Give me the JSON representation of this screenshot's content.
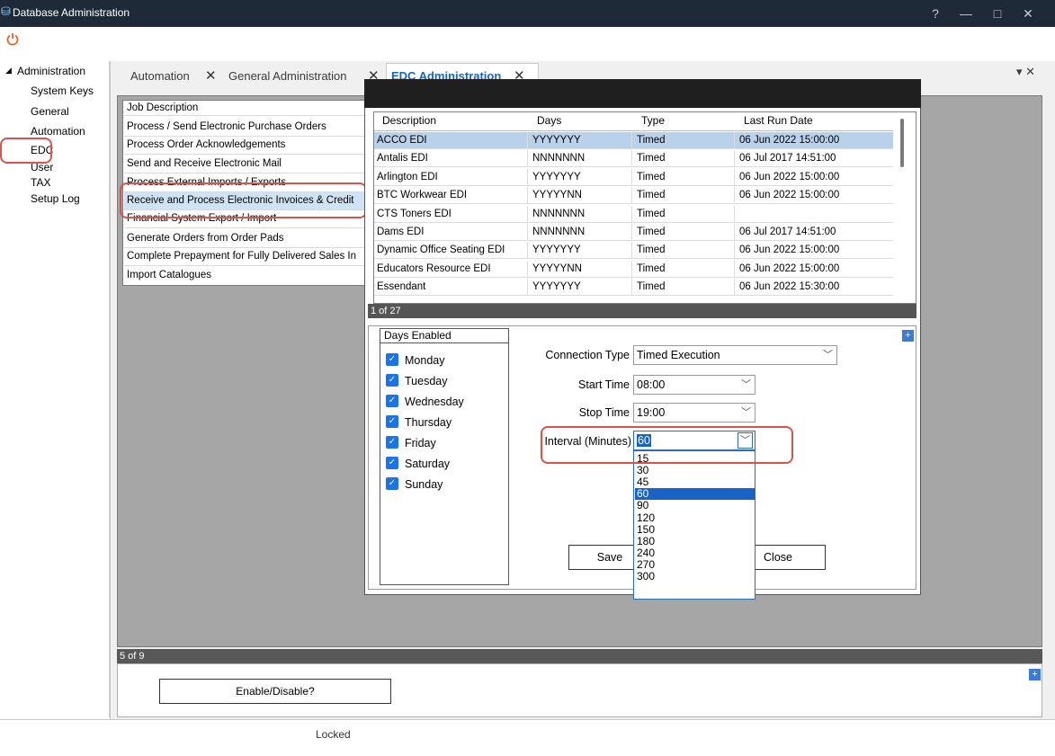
{
  "window": {
    "title": "Database Administration",
    "help": "?",
    "minimize": "—",
    "maximize": "□",
    "close": "✕"
  },
  "sidebar": {
    "root": "Administration",
    "items": [
      "System Keys",
      "General",
      "Automation",
      "EDC",
      "User",
      "TAX",
      "Setup Log"
    ]
  },
  "tabs": [
    {
      "label": "Automation",
      "close": "✕"
    },
    {
      "label": "General Administration",
      "close": "✕"
    },
    {
      "label": "EDC Administration",
      "close": "✕"
    }
  ],
  "tab_controls": "▾ ✕",
  "jobs": {
    "header": "Job Description",
    "rows": [
      "Process / Send Electronic Purchase Orders",
      "Process Order Acknowledgements",
      "Send and Receive Electronic Mail",
      "Process External Imports / Exports",
      "Receive and Process Electronic Invoices & Credit",
      "Financial System Export / Import",
      "Generate Orders from Order Pads",
      "Complete Prepayment for Fully Delivered Sales In",
      "Import Catalogues"
    ],
    "status": "5 of 9"
  },
  "enable_button": "Enable/Disable?",
  "status_bar": "Locked",
  "dialog": {
    "grid": {
      "headers": [
        "Description",
        "Days",
        "Type",
        "Last Run Date"
      ],
      "rows": [
        {
          "description": "ACCO EDI",
          "days": "YYYYYYY",
          "type": "Timed",
          "last_run": "06 Jun 2022 15:00:00"
        },
        {
          "description": "Antalis EDI",
          "days": "NNNNNNN",
          "type": "Timed",
          "last_run": "06 Jul 2017 14:51:00"
        },
        {
          "description": "Arlington EDI",
          "days": "YYYYYYY",
          "type": "Timed",
          "last_run": "06 Jun 2022 15:00:00"
        },
        {
          "description": "BTC Workwear EDI",
          "days": "YYYYYNN",
          "type": "Timed",
          "last_run": "06 Jun 2022 15:00:00"
        },
        {
          "description": "CTS Toners EDI",
          "days": "NNNNNNN",
          "type": "Timed",
          "last_run": ""
        },
        {
          "description": "Dams EDI",
          "days": "NNNNNNN",
          "type": "Timed",
          "last_run": "06 Jul 2017 14:51:00"
        },
        {
          "description": "Dynamic Office Seating EDI",
          "days": "YYYYYYY",
          "type": "Timed",
          "last_run": "06 Jun 2022 15:00:00"
        },
        {
          "description": "Educators Resource EDI",
          "days": "YYYYYNN",
          "type": "Timed",
          "last_run": "06 Jun 2022 15:00:00"
        },
        {
          "description": "Essendant",
          "days": "YYYYYYY",
          "type": "Timed",
          "last_run": "06 Jun 2022 15:30:00"
        }
      ],
      "status": "1 of 27"
    },
    "days_title": "Days Enabled",
    "days": [
      "Monday",
      "Tuesday",
      "Wednesday",
      "Thursday",
      "Friday",
      "Saturday",
      "Sunday"
    ],
    "fields": {
      "connection_type": {
        "label": "Connection Type",
        "value": "Timed Execution"
      },
      "start_time": {
        "label": "Start Time",
        "value": "08:00"
      },
      "stop_time": {
        "label": "Stop Time",
        "value": "19:00"
      },
      "interval": {
        "label": "Interval (Minutes)",
        "value": "60"
      }
    },
    "interval_options": [
      "15",
      "30",
      "45",
      "60",
      "90",
      "120",
      "150",
      "180",
      "240",
      "270",
      "300"
    ],
    "interval_selected": "60",
    "save_button": "Save",
    "close_button": "Close",
    "plus": "+"
  }
}
